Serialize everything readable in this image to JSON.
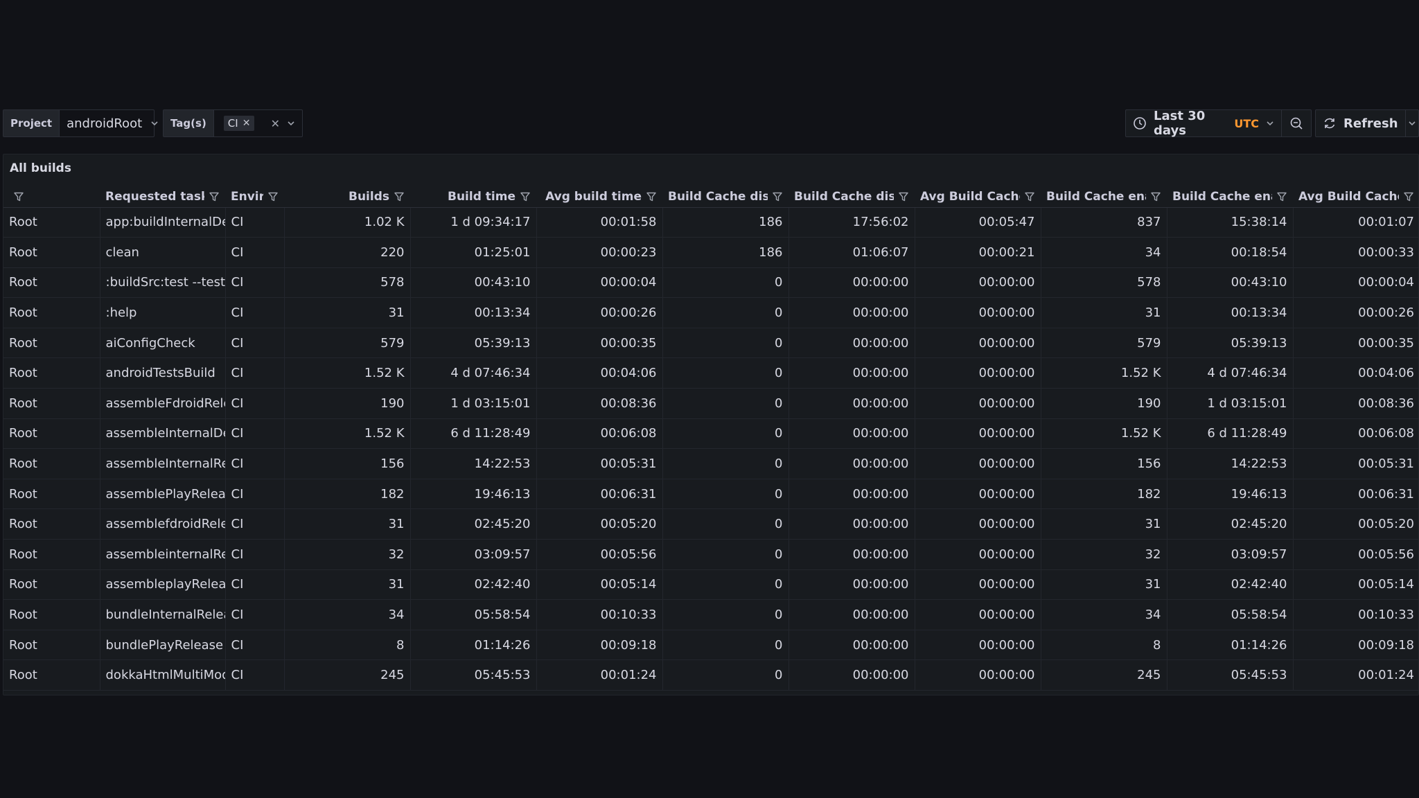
{
  "toolbar": {
    "project_label": "Project",
    "project_value": "androidRoot",
    "tags_label": "Tag(s)",
    "tags": [
      "CI"
    ],
    "time_range": "Last 30 days",
    "timezone": "UTC",
    "refresh_label": "Refresh"
  },
  "panel": {
    "title": "All builds"
  },
  "columns": [
    {
      "label": "",
      "align": "left",
      "width": 139
    },
    {
      "label": "Requested tasks",
      "align": "left",
      "width": 181
    },
    {
      "label": "Enviro",
      "align": "left",
      "width": 85
    },
    {
      "label": "Builds",
      "align": "right",
      "width": 182
    },
    {
      "label": "Build time",
      "align": "right",
      "width": 182
    },
    {
      "label": "Avg build time",
      "align": "right",
      "width": 182
    },
    {
      "label": "Build Cache disab",
      "align": "right",
      "width": 182
    },
    {
      "label": "Build Cache disab",
      "align": "right",
      "width": 182
    },
    {
      "label": "Avg Build Cache d",
      "align": "right",
      "width": 182
    },
    {
      "label": "Build Cache enab",
      "align": "right",
      "width": 182
    },
    {
      "label": "Build Cache enab",
      "align": "right",
      "width": 182
    },
    {
      "label": "Avg Build Cache e",
      "align": "right",
      "width": 183
    }
  ],
  "rows": [
    [
      "Root",
      "app:buildInternalDebug",
      "CI",
      "1.02 K",
      "1 d 09:34:17",
      "00:01:58",
      "186",
      "17:56:02",
      "00:05:47",
      "837",
      "15:38:14",
      "00:01:07"
    ],
    [
      "Root",
      "clean",
      "CI",
      "220",
      "01:25:01",
      "00:00:23",
      "186",
      "01:06:07",
      "00:00:21",
      "34",
      "00:18:54",
      "00:00:33"
    ],
    [
      "Root",
      ":buildSrc:test --tests",
      "CI",
      "578",
      "00:43:10",
      "00:00:04",
      "0",
      "00:00:00",
      "00:00:00",
      "578",
      "00:43:10",
      "00:00:04"
    ],
    [
      "Root",
      ":help",
      "CI",
      "31",
      "00:13:34",
      "00:00:26",
      "0",
      "00:00:00",
      "00:00:00",
      "31",
      "00:13:34",
      "00:00:26"
    ],
    [
      "Root",
      "aiConfigCheck",
      "CI",
      "579",
      "05:39:13",
      "00:00:35",
      "0",
      "00:00:00",
      "00:00:00",
      "579",
      "05:39:13",
      "00:00:35"
    ],
    [
      "Root",
      "androidTestsBuild",
      "CI",
      "1.52 K",
      "4 d 07:46:34",
      "00:04:06",
      "0",
      "00:00:00",
      "00:00:00",
      "1.52 K",
      "4 d 07:46:34",
      "00:04:06"
    ],
    [
      "Root",
      "assembleFdroidRelease",
      "CI",
      "190",
      "1 d 03:15:01",
      "00:08:36",
      "0",
      "00:00:00",
      "00:00:00",
      "190",
      "1 d 03:15:01",
      "00:08:36"
    ],
    [
      "Root",
      "assembleInternalDebug",
      "CI",
      "1.52 K",
      "6 d 11:28:49",
      "00:06:08",
      "0",
      "00:00:00",
      "00:00:00",
      "1.52 K",
      "6 d 11:28:49",
      "00:06:08"
    ],
    [
      "Root",
      "assembleInternalRelease",
      "CI",
      "156",
      "14:22:53",
      "00:05:31",
      "0",
      "00:00:00",
      "00:00:00",
      "156",
      "14:22:53",
      "00:05:31"
    ],
    [
      "Root",
      "assemblePlayRelease",
      "CI",
      "182",
      "19:46:13",
      "00:06:31",
      "0",
      "00:00:00",
      "00:00:00",
      "182",
      "19:46:13",
      "00:06:31"
    ],
    [
      "Root",
      "assemblefdroidRelease",
      "CI",
      "31",
      "02:45:20",
      "00:05:20",
      "0",
      "00:00:00",
      "00:00:00",
      "31",
      "02:45:20",
      "00:05:20"
    ],
    [
      "Root",
      "assembleinternalRelease",
      "CI",
      "32",
      "03:09:57",
      "00:05:56",
      "0",
      "00:00:00",
      "00:00:00",
      "32",
      "03:09:57",
      "00:05:56"
    ],
    [
      "Root",
      "assembleplayRelease",
      "CI",
      "31",
      "02:42:40",
      "00:05:14",
      "0",
      "00:00:00",
      "00:00:00",
      "31",
      "02:42:40",
      "00:05:14"
    ],
    [
      "Root",
      "bundleInternalRelease",
      "CI",
      "34",
      "05:58:54",
      "00:10:33",
      "0",
      "00:00:00",
      "00:00:00",
      "34",
      "05:58:54",
      "00:10:33"
    ],
    [
      "Root",
      "bundlePlayRelease",
      "CI",
      "8",
      "01:14:26",
      "00:09:18",
      "0",
      "00:00:00",
      "00:00:00",
      "8",
      "01:14:26",
      "00:09:18"
    ],
    [
      "Root",
      "dokkaHtmlMultiModule",
      "CI",
      "245",
      "05:45:53",
      "00:01:24",
      "0",
      "00:00:00",
      "00:00:00",
      "245",
      "05:45:53",
      "00:01:24"
    ]
  ],
  "icons": {
    "filter": "filter-icon",
    "clock": "clock-icon",
    "zoom_out": "zoom-out-icon",
    "refresh": "refresh-icon",
    "chevron": "chevron-down-icon",
    "remove": "close-icon"
  }
}
